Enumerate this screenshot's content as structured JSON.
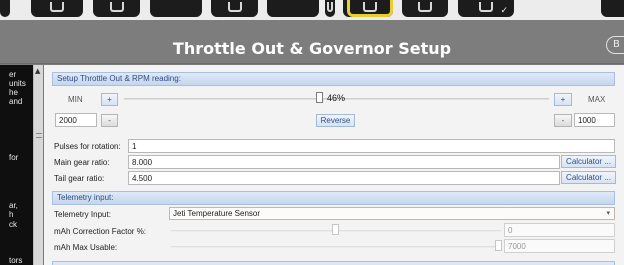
{
  "toolbar": {
    "icons": [
      "page-icon",
      "tools-icon",
      "generic-tab-icon",
      "hand-icon",
      "generic-tab-icon",
      "servo-icon",
      "generic-tab-icon",
      "helicopter-icon",
      "gauge-icon",
      "check-icon"
    ]
  },
  "header": {
    "title": "Throttle Out & Governor Setup",
    "right_icon_label": "B"
  },
  "help_panel": {
    "lines": [
      "er",
      "units",
      "he",
      "and",
      "for",
      "ar,",
      "h",
      "ck",
      "tors"
    ]
  },
  "throttle_section": {
    "header": "Setup Throttle Out & RPM reading:",
    "min_label": "MIN",
    "max_label": "MAX",
    "plus": "+",
    "minus": "-",
    "min_value": "2000",
    "max_value": "1000",
    "percent_text": "46%",
    "percent_value": 46,
    "reverse_label": "Reverse",
    "pulses_label": "Pulses for rotation:",
    "pulses_value": "1",
    "main_gear_label": "Main gear ratio:",
    "main_gear_value": "8.000",
    "tail_gear_label": "Tail gear ratio:",
    "tail_gear_value": "4.500",
    "calculator_label": "Calculator ..."
  },
  "telemetry_section": {
    "header": "Telemetry input:",
    "input_label": "Telemetry Input:",
    "input_value": "Jeti Temperature Sensor",
    "mah_correction_label": "mAh Correction Factor %:",
    "mah_correction_value": "0",
    "mah_max_label": "mAh Max Usable:",
    "mah_max_value": "7000"
  },
  "colors": {
    "accent_yellow": "#e8cf2e",
    "section_header_blue": "#2d4c86",
    "title_white": "#ffffff"
  }
}
